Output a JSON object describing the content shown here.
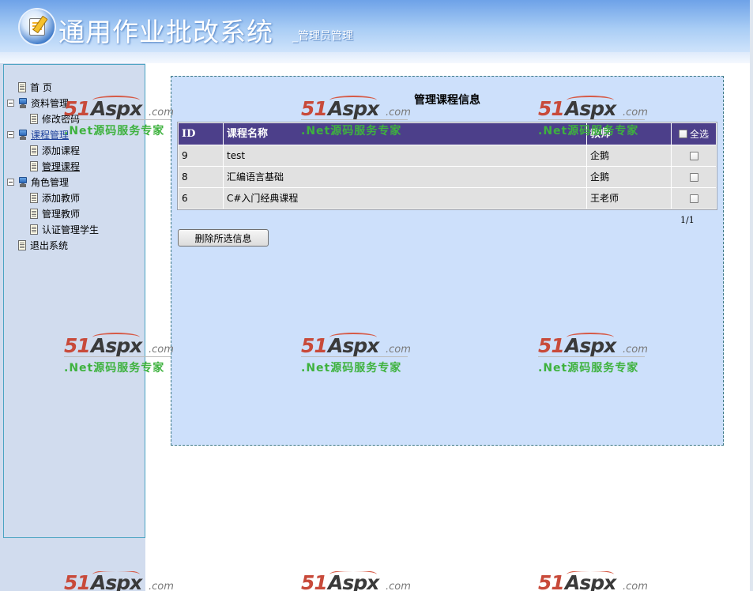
{
  "header": {
    "title": "通用作业批改系统",
    "subtitle": "_管理员管理"
  },
  "sidebar": {
    "items": [
      {
        "label": "首  页",
        "kind": "doc"
      },
      {
        "label": "资料管理",
        "kind": "group"
      },
      {
        "label": "修改密码",
        "kind": "doc"
      },
      {
        "label": "课程管理",
        "kind": "group"
      },
      {
        "label": "添加课程",
        "kind": "doc"
      },
      {
        "label": "管理课程",
        "kind": "doc"
      },
      {
        "label": "角色管理",
        "kind": "group"
      },
      {
        "label": "添加教师",
        "kind": "doc"
      },
      {
        "label": "管理教师",
        "kind": "doc"
      },
      {
        "label": "认证管理学生",
        "kind": "doc"
      },
      {
        "label": "退出系统",
        "kind": "doc"
      }
    ]
  },
  "main": {
    "title": "管理课程信息",
    "table": {
      "columns": [
        "ID",
        "课程名称",
        "教师"
      ],
      "select_all_label": "全选",
      "rows": [
        {
          "id": "9",
          "name": "test",
          "teacher": "企鹅"
        },
        {
          "id": "8",
          "name": "汇编语言基础",
          "teacher": "企鹅"
        },
        {
          "id": "6",
          "name": "C#入门经典课程",
          "teacher": "王老师"
        }
      ]
    },
    "pager": "1/1",
    "delete_button": "删除所选信息"
  },
  "watermark": {
    "n51": "51",
    "aspx": "Aspx",
    "domain": ".com",
    "slogan": ".Net源码服务专家"
  },
  "colors": {
    "table_header": "#4c3f8a",
    "panel_bg": "#cde0fb",
    "sidebar_bg": "#d1dcee",
    "watermark_green": "#3eb23e",
    "watermark_red": "#c84a3a"
  }
}
